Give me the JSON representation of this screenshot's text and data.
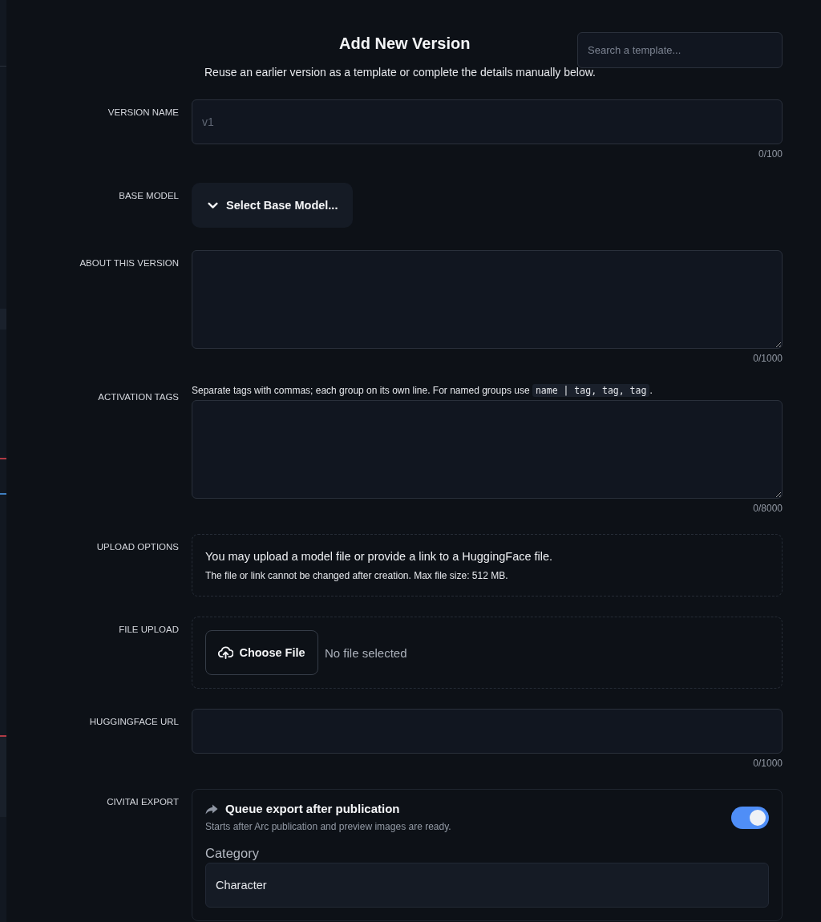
{
  "dialog": {
    "title": "Add New Version",
    "subtitle": "Reuse an earlier version as a template or complete the details manually below.",
    "template_search": {
      "placeholder": "Search a template..."
    }
  },
  "fields": [
    {
      "kind": "text",
      "label": "VERSION NAME",
      "placeholder": "v1",
      "counter": "0/100"
    },
    {
      "kind": "dropdown",
      "label": "BASE MODEL",
      "button": "Select Base Model..."
    },
    {
      "kind": "textarea",
      "label": "ABOUT THIS VERSION",
      "counter": "0/1000"
    },
    {
      "kind": "textarea",
      "label": "ACTIVATION TAGS",
      "hint": "Separate tags with commas; each group on its own line. For named groups use",
      "hint_code": "name | tag, tag, tag",
      "hint_end": ".",
      "counter": "0/8000"
    },
    {
      "kind": "notice",
      "label": "UPLOAD OPTIONS",
      "text": "You may upload a model file or provide a link to a HuggingFace file.",
      "note": "The file or link cannot be changed after creation. Max file size: 512 MB."
    },
    {
      "kind": "file",
      "label": "FILE UPLOAD",
      "button": "Choose File",
      "status": "No file selected"
    },
    {
      "kind": "text",
      "label": "HUGGINGFACE URL",
      "counter": "0/1000"
    },
    {
      "kind": "export",
      "label": "CIVITAI EXPORT",
      "title": "Queue export after publication",
      "description": "Starts after Arc publication and preview images are ready.",
      "on": true,
      "category_label": "Category",
      "category_value": "Character"
    }
  ]
}
